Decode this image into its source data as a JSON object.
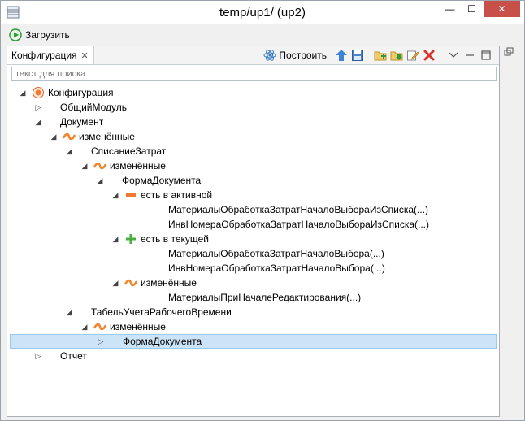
{
  "window": {
    "title": "temp/up1/ (up2)",
    "min_label": "—",
    "max_label": "☐",
    "close_label": "✕"
  },
  "toolbar_top": {
    "load_label": "Загрузить"
  },
  "view": {
    "tab_label": "Конфигурация",
    "tab_close": "✕",
    "build_label": "Построить",
    "search_placeholder": "текст для поиска"
  },
  "tree": [
    {
      "label": "Конфигурация",
      "level": 0,
      "twisty": "◢",
      "icon": "config-icon"
    },
    {
      "label": "ОбщийМодуль",
      "level": 1,
      "twisty": "▷",
      "icon": "none"
    },
    {
      "label": "Документ",
      "level": 1,
      "twisty": "◢",
      "icon": "none"
    },
    {
      "label": "изменённые",
      "level": 2,
      "twisty": "◢",
      "icon": "changed-icon"
    },
    {
      "label": "СписаниеЗатрат",
      "level": 3,
      "twisty": "◢",
      "icon": "none"
    },
    {
      "label": "изменённые",
      "level": 4,
      "twisty": "◢",
      "icon": "changed-icon"
    },
    {
      "label": "ФормаДокумента",
      "level": 5,
      "twisty": "◢",
      "icon": "none"
    },
    {
      "label": "есть в активной",
      "level": 6,
      "twisty": "◢",
      "icon": "minus-icon"
    },
    {
      "label": "МатериалыОбработкаЗатратНачалоВыбораИзСписка(...)",
      "level": 8,
      "twisty": "",
      "icon": "none"
    },
    {
      "label": "ИнвНомераОбработкаЗатратНачалоВыбораИзСписка(...)",
      "level": 8,
      "twisty": "",
      "icon": "none"
    },
    {
      "label": "есть в текущей",
      "level": 6,
      "twisty": "◢",
      "icon": "plus-icon"
    },
    {
      "label": "МатериалыОбработкаЗатратНачалоВыбора(...)",
      "level": 8,
      "twisty": "",
      "icon": "none"
    },
    {
      "label": "ИнвНомераОбработкаЗатратНачалоВыбора(...)",
      "level": 8,
      "twisty": "",
      "icon": "none"
    },
    {
      "label": "изменённые",
      "level": 6,
      "twisty": "◢",
      "icon": "changed-icon"
    },
    {
      "label": "МатериалыПриНачалеРедактирования(...)",
      "level": 8,
      "twisty": "",
      "icon": "none"
    },
    {
      "label": "ТабельУчетаРабочегоВремени",
      "level": 3,
      "twisty": "◢",
      "icon": "none"
    },
    {
      "label": "изменённые",
      "level": 4,
      "twisty": "◢",
      "icon": "changed-icon"
    },
    {
      "label": "ФормаДокумента",
      "level": 5,
      "twisty": "▷",
      "icon": "none",
      "selected": true
    },
    {
      "label": "Отчет",
      "level": 1,
      "twisty": "▷",
      "icon": "none"
    }
  ]
}
